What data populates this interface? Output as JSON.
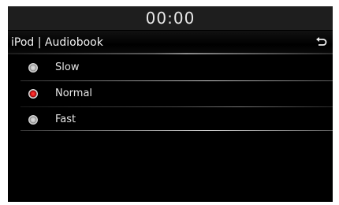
{
  "status_bar": {
    "clock": "00:00"
  },
  "header": {
    "title": "iPod | Audiobook",
    "back_icon": "return-arrow-icon"
  },
  "options": [
    {
      "label": "Slow",
      "selected": false
    },
    {
      "label": "Normal",
      "selected": true
    },
    {
      "label": "Fast",
      "selected": false
    }
  ],
  "colors": {
    "background": "#000000",
    "clock_bar": "#1e1e1e",
    "selected_radio": "#e01010",
    "text": "#e6e6e6"
  }
}
